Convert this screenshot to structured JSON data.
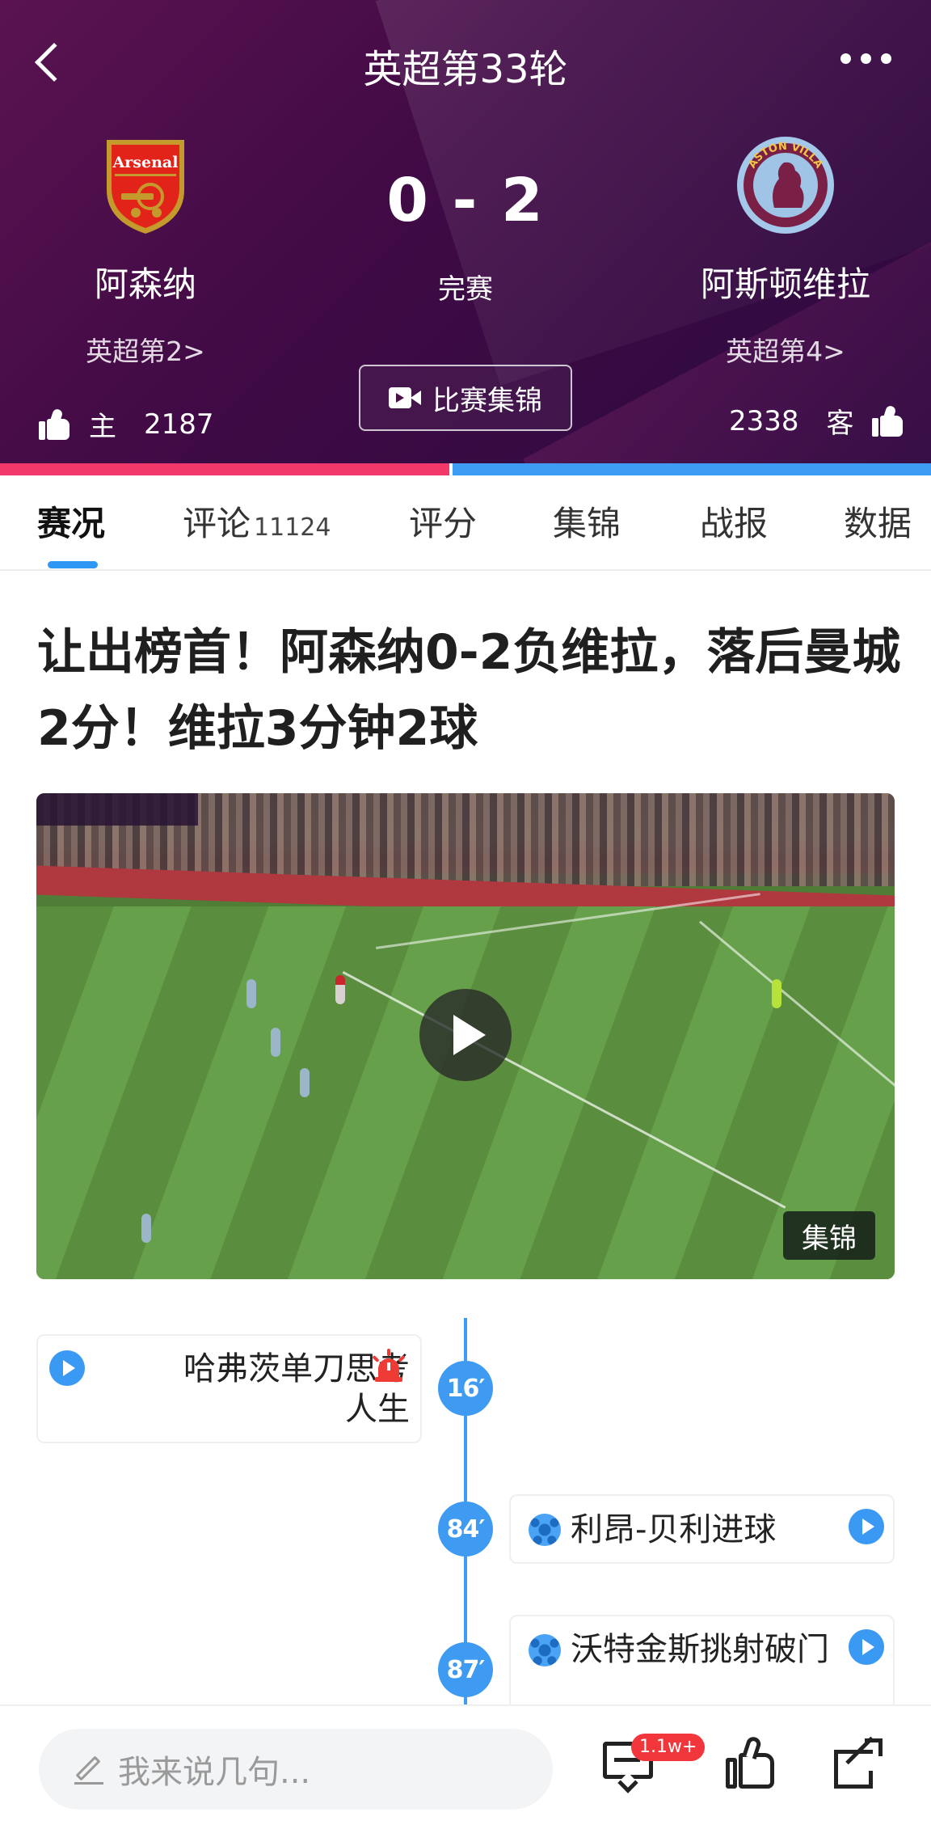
{
  "header": {
    "title": "英超第33轮",
    "score": "0 - 2",
    "status": "完赛",
    "highlights_button": "比赛集锦"
  },
  "home_team": {
    "name": "阿森纳",
    "rank": "英超第2>",
    "logo_text": "Arsenal",
    "side_label": "主",
    "likes": "2187",
    "color": "#f2376a"
  },
  "away_team": {
    "name": "阿斯顿维拉",
    "rank": "英超第4>",
    "logo_text": "ASTON VILLA",
    "side_label": "客",
    "likes": "2338",
    "color": "#3f9cf5"
  },
  "vote_share_home": 0.483,
  "tabs": [
    {
      "label": "赛况",
      "count": "",
      "active": true
    },
    {
      "label": "评论",
      "count": "11124",
      "active": false
    },
    {
      "label": "评分",
      "count": "",
      "active": false
    },
    {
      "label": "集锦",
      "count": "",
      "active": false
    },
    {
      "label": "战报",
      "count": "",
      "active": false
    },
    {
      "label": "数据",
      "count": "",
      "active": false
    }
  ],
  "article": {
    "headline": "让出榜首！阿森纳0-2负维拉，落后曼城2分！维拉3分钟2球",
    "video_badge": "集锦"
  },
  "timeline": [
    {
      "minute": "16′",
      "side": "home",
      "text": "哈弗茨单刀思考人生",
      "icon": "alarm-icon"
    },
    {
      "minute": "84′",
      "side": "away",
      "text": "利昂-贝利进球",
      "icon": "ball-icon"
    },
    {
      "minute": "87′",
      "side": "away",
      "text": "沃特金斯挑射破门",
      "icon": "ball-icon"
    }
  ],
  "bottom_bar": {
    "comment_placeholder": "我来说几句...",
    "comment_badge": "1.1w+"
  },
  "colors": {
    "header_bg": "#4a0f49",
    "accent_blue": "#3e9bf1",
    "home_bar": "#f2376a",
    "away_bar": "#3f9cf5"
  }
}
